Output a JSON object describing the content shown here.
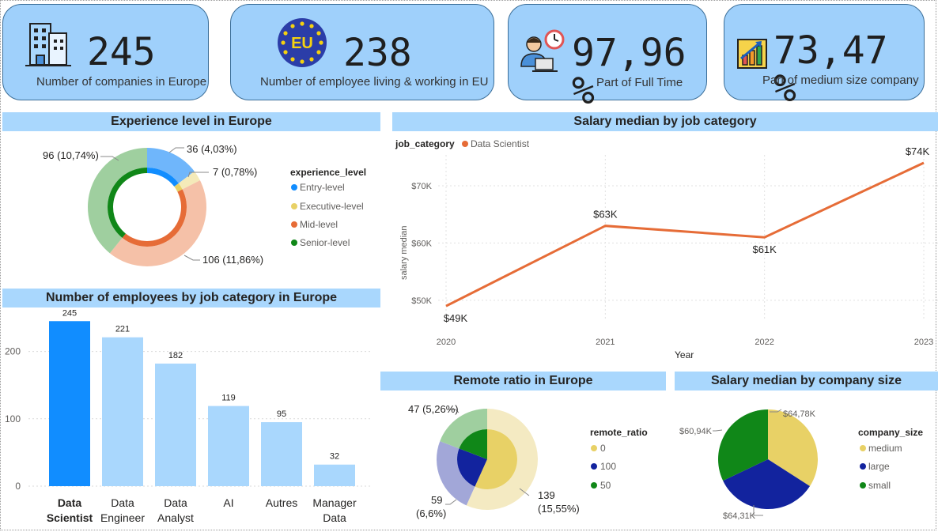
{
  "kpis": [
    {
      "value": "245",
      "label": "Number of companies in Europe",
      "icon": "office-building-icon"
    },
    {
      "value": "238",
      "label": "Number of employee living & working in EU",
      "icon": "eu-flag-icon"
    },
    {
      "value": "97,96 %",
      "label": "Part of Full Time",
      "icon": "worker-clock-icon"
    },
    {
      "value": "73,47 %",
      "label": "Part of medium size company",
      "icon": "growth-chart-icon"
    }
  ],
  "titles": {
    "experience": "Experience level in Europe",
    "salary_job": "Salary median by job category",
    "employees": "Number of employees by job category in Europe",
    "remote": "Remote ratio in Europe",
    "salary_size": "Salary median by company size"
  },
  "colors": {
    "entry": "#118dff",
    "executive": "#e8d166",
    "mid": "#e66c37",
    "senior": "#108718",
    "dark_blue": "#12239e",
    "bar_highlight": "#118dff",
    "bar_normal": "#a9d7fd",
    "kpi_bg": "#9fd0fb"
  },
  "chart_data": [
    {
      "type": "pie",
      "title": "Experience level in Europe",
      "legend_title": "experience_level",
      "legend_position": "right",
      "labels": [
        "Entry-level",
        "Executive-level",
        "Mid-level",
        "Senior-level"
      ],
      "values": [
        36,
        7,
        106,
        96
      ],
      "data_labels": [
        "36 (4,03%)",
        "7 (0,78%)",
        "106 (11,86%)",
        "96 (10,74%)"
      ]
    },
    {
      "type": "line",
      "title": "Salary median by job category",
      "legend_title": "job_category",
      "series": [
        {
          "name": "Data Scientist",
          "values": [
            49,
            63,
            61,
            74
          ]
        }
      ],
      "x": [
        "2020",
        "2021",
        "2022",
        "2023"
      ],
      "xlabel": "Year",
      "ylabel": "salary median",
      "yticks": [
        "$50K",
        "$60K",
        "$70K"
      ],
      "ytick_values": [
        50,
        60,
        70
      ],
      "ylim": [
        47.5,
        74
      ],
      "data_labels": [
        "$49K",
        "$63K",
        "$61K",
        "$74K"
      ],
      "grid": true
    },
    {
      "type": "bar",
      "title": "Number of employees by job category in Europe",
      "categories": [
        "Data Scientist",
        "Data Engineer",
        "Data Analyst",
        "AI",
        "Autres",
        "Manager Data"
      ],
      "category_lines": [
        [
          "Data",
          "Scientist"
        ],
        [
          "Data",
          "Engineer"
        ],
        [
          "Data",
          "Analyst"
        ],
        [
          "AI"
        ],
        [
          "Autres"
        ],
        [
          "Manager",
          "Data"
        ]
      ],
      "values": [
        245,
        221,
        182,
        119,
        95,
        32
      ],
      "yticks": [
        "0",
        "100",
        "200"
      ],
      "ytick_values": [
        0,
        100,
        200
      ],
      "ylim": [
        0,
        250
      ]
    },
    {
      "type": "pie",
      "title": "Remote ratio in Europe",
      "legend_title": "remote_ratio",
      "legend_position": "right",
      "labels": [
        "0",
        "100",
        "50"
      ],
      "values": [
        139,
        59,
        47
      ],
      "data_labels": [
        [
          "139",
          "(15,55%)"
        ],
        [
          "59",
          "(6,6%)"
        ],
        [
          "47 (5,26%)"
        ]
      ]
    },
    {
      "type": "pie",
      "title": "Salary median by company size",
      "legend_title": "company_size",
      "legend_position": "right",
      "labels": [
        "medium",
        "large",
        "small"
      ],
      "values": [
        64.78,
        64.31,
        60.94
      ],
      "data_labels": [
        "$64,78K",
        "$64,31K",
        "$60,94K"
      ]
    }
  ]
}
